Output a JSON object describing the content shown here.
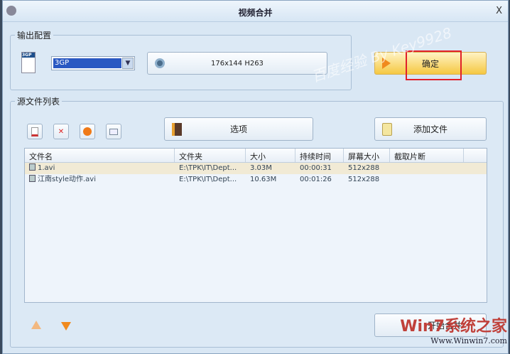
{
  "window": {
    "title": "视频合并",
    "close": "X"
  },
  "output_config": {
    "legend": "输出配置",
    "format_value": "3GP",
    "format_icon_label": "3GP",
    "profile_label": "176x144 H263",
    "ok_label": "确定"
  },
  "source_list": {
    "legend": "源文件列表",
    "options_label": "选项",
    "add_file_label": "添加文件",
    "start_label": "开始合并",
    "columns": [
      "文件名",
      "文件夹",
      "大小",
      "持续时间",
      "屏幕大小",
      "截取片断"
    ],
    "rows": [
      {
        "name": "1.avi",
        "folder": "E:\\TPK\\IT\\Dept...",
        "size": "3.03M",
        "duration": "00:00:31",
        "screen": "512x288",
        "clip": ""
      },
      {
        "name": "江南style动作.avi",
        "folder": "E:\\TPK\\IT\\Dept...",
        "size": "10.63M",
        "duration": "00:01:26",
        "screen": "512x288",
        "clip": ""
      }
    ]
  },
  "watermarks": {
    "top": "百度经验 By Key9928",
    "bottom": "Win7系统之家",
    "bottom_url": "Www.Winwin7.com"
  },
  "colors": {
    "accent": "#f5c842",
    "selection": "#2a58c2",
    "highlight_box": "#e0202a"
  }
}
